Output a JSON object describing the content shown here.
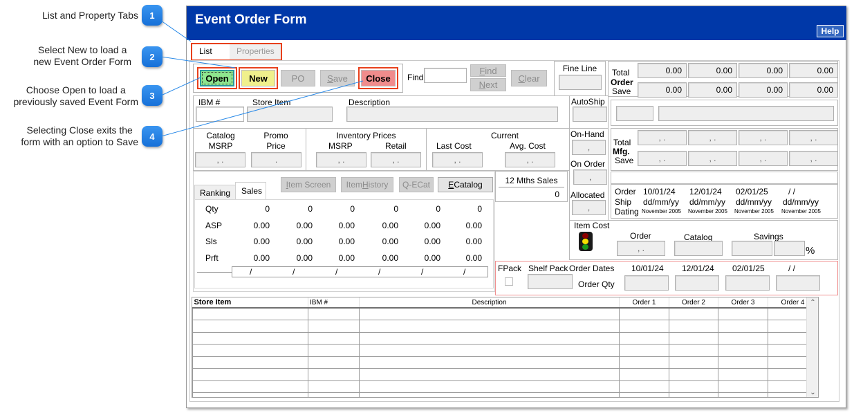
{
  "callouts": [
    {
      "number": "1",
      "text": "List and Property Tabs"
    },
    {
      "number": "2",
      "text": "Select New to load a new Event Order Form"
    },
    {
      "number": "3",
      "text": "Choose Open to load a previously saved Event Form"
    },
    {
      "number": "4",
      "text": "Selecting Close exits the form with an option to Save"
    }
  ],
  "callout_lines": {
    "1a": "List and Property Tabs",
    "2a": "Select New to load a",
    "2b": "new Event Order Form",
    "3a": "Choose Open to load a",
    "3b": "previously saved Event Form",
    "4a": "Selecting Close exits the",
    "4b": "form with an option to Save"
  },
  "window": {
    "title": "Event Order Form",
    "help_label": "Help"
  },
  "tabs": [
    {
      "label": "List",
      "active": true
    },
    {
      "label": "Properties",
      "active": false
    }
  ],
  "toolbar": {
    "open": "Open",
    "new": "New",
    "po": "PO",
    "save": "Save",
    "close": "Close",
    "find_label": "Find",
    "find_value": "",
    "find_btn": "Find",
    "next_btn": "Next",
    "clear_btn": "Clear",
    "fine_line_label": "Fine Line"
  },
  "colors": {
    "open": "#8ee68e",
    "new": "#f0f08c",
    "close": "#f08c8c",
    "title_bar": "#0038a8",
    "highlight": "#e8401c"
  },
  "total_order": {
    "label_total": "Total",
    "label_order": "Order",
    "label_save": "Save",
    "total_values": [
      "0.00",
      "0.00",
      "0.00",
      "0.00"
    ],
    "save_values": [
      "0.00",
      "0.00",
      "0.00",
      "0.00"
    ]
  },
  "item": {
    "ibm_label": "IBM #",
    "store_item_label": "Store Item",
    "description_label": "Description",
    "autoship_label": "AutoShip"
  },
  "prices": {
    "catalog_label": "Catalog",
    "msrp_label": "MSRP",
    "promo_label": "Promo",
    "price_label": "Price",
    "inventory_prices_label": "Inventory Prices",
    "inv_msrp_label": "MSRP",
    "retail_label": "Retail",
    "current_label": "Current",
    "last_cost_label": "Last Cost",
    "avg_cost_label": "Avg. Cost",
    "catalog_msrp_value": ",  .",
    "promo_value": ".",
    "inv_msrp_value": ",  .",
    "retail_value": ",  .",
    "last_cost_value": ",  .",
    "avg_cost_value": ",  ."
  },
  "inventory": {
    "on_hand_label": "On-Hand",
    "on_hand_value": ",",
    "on_order_label": "On Order",
    "on_order_value": ",",
    "allocated_label": "Allocated",
    "allocated_value": ","
  },
  "total_mfg": {
    "label_total": "Total",
    "label_mfg": "Mfg.",
    "label_save": "Save",
    "total_values": [
      ",  .",
      ",  .",
      ",  .",
      ",  ."
    ],
    "save_values": [
      ",  .",
      ",  .",
      ",  .",
      ",  ."
    ]
  },
  "dates": {
    "order_label": "Order",
    "ship_label": "Ship",
    "dating_label": "Dating",
    "order_dates": [
      "10/01/24",
      "12/01/24",
      "02/01/25",
      "/  /"
    ],
    "ship_dates": [
      "dd/mm/yy",
      "dd/mm/yy",
      "dd/mm/yy",
      "dd/mm/yy"
    ],
    "dating": [
      "November 2005",
      "November 2005",
      "November 2005",
      "November 2005"
    ]
  },
  "sales_panel": {
    "tabs": [
      {
        "label": "Ranking"
      },
      {
        "label": "Sales"
      }
    ],
    "buttons": {
      "item_screen": "Item Screen",
      "item_history": "Item History",
      "q_ecat": "Q-ECat",
      "ecatalog": "ECatalog"
    },
    "rows": [
      {
        "label": "Qty",
        "values": [
          "0",
          "0",
          "0",
          "0",
          "0",
          "0"
        ]
      },
      {
        "label": "ASP",
        "values": [
          "0.00",
          "0.00",
          "0.00",
          "0.00",
          "0.00",
          "0.00"
        ]
      },
      {
        "label": "Sls",
        "values": [
          "0.00",
          "0.00",
          "0.00",
          "0.00",
          "0.00",
          "0.00"
        ]
      },
      {
        "label": "Prft",
        "values": [
          "0.00",
          "0.00",
          "0.00",
          "0.00",
          "0.00",
          "0.00"
        ]
      }
    ],
    "period_values": [
      "/",
      "/",
      "/",
      "/",
      "/",
      "/"
    ],
    "twelve_months_label": "12 Mths Sales",
    "twelve_months_value": "0"
  },
  "item_cost": {
    "label": "Item Cost",
    "order_label": "Order",
    "catalog_label": "Catalog",
    "savings_label": "Savings",
    "order_value": ",  .",
    "percent_symbol": "%"
  },
  "order_qty": {
    "fpack_label": "FPack",
    "shelf_pack_label": "Shelf Pack",
    "order_dates_label": "Order Dates",
    "order_qty_label": "Order Qty",
    "dates": [
      "10/01/24",
      "12/01/24",
      "02/01/25",
      "/  /"
    ]
  },
  "grid": {
    "columns": [
      "Store Item",
      "IBM #",
      "Description",
      "Order 1",
      "Order 2",
      "Order 3",
      "Order 4"
    ],
    "row_count": 8
  }
}
